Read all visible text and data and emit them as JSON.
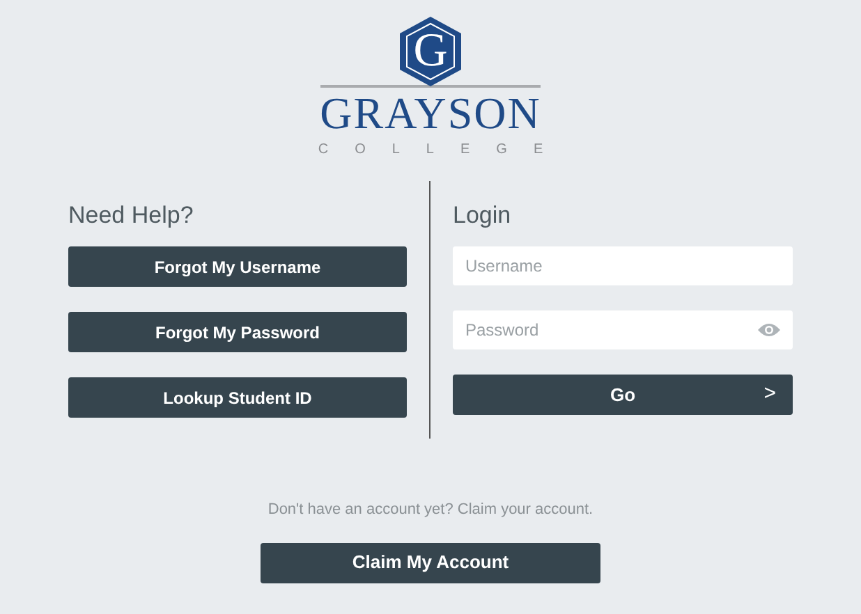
{
  "logo": {
    "mark": "G",
    "name": "GRAYSON",
    "subtitle": "COLLEGE"
  },
  "help": {
    "title": "Need Help?",
    "buttons": [
      "Forgot My Username",
      "Forgot My Password",
      "Lookup Student ID"
    ]
  },
  "login": {
    "title": "Login",
    "username": {
      "placeholder": "Username"
    },
    "password": {
      "placeholder": "Password"
    },
    "submit": "Go",
    "submit_icon": ">"
  },
  "claim": {
    "prompt": "Don't have an account yet? Claim your account.",
    "button": "Claim My Account"
  }
}
